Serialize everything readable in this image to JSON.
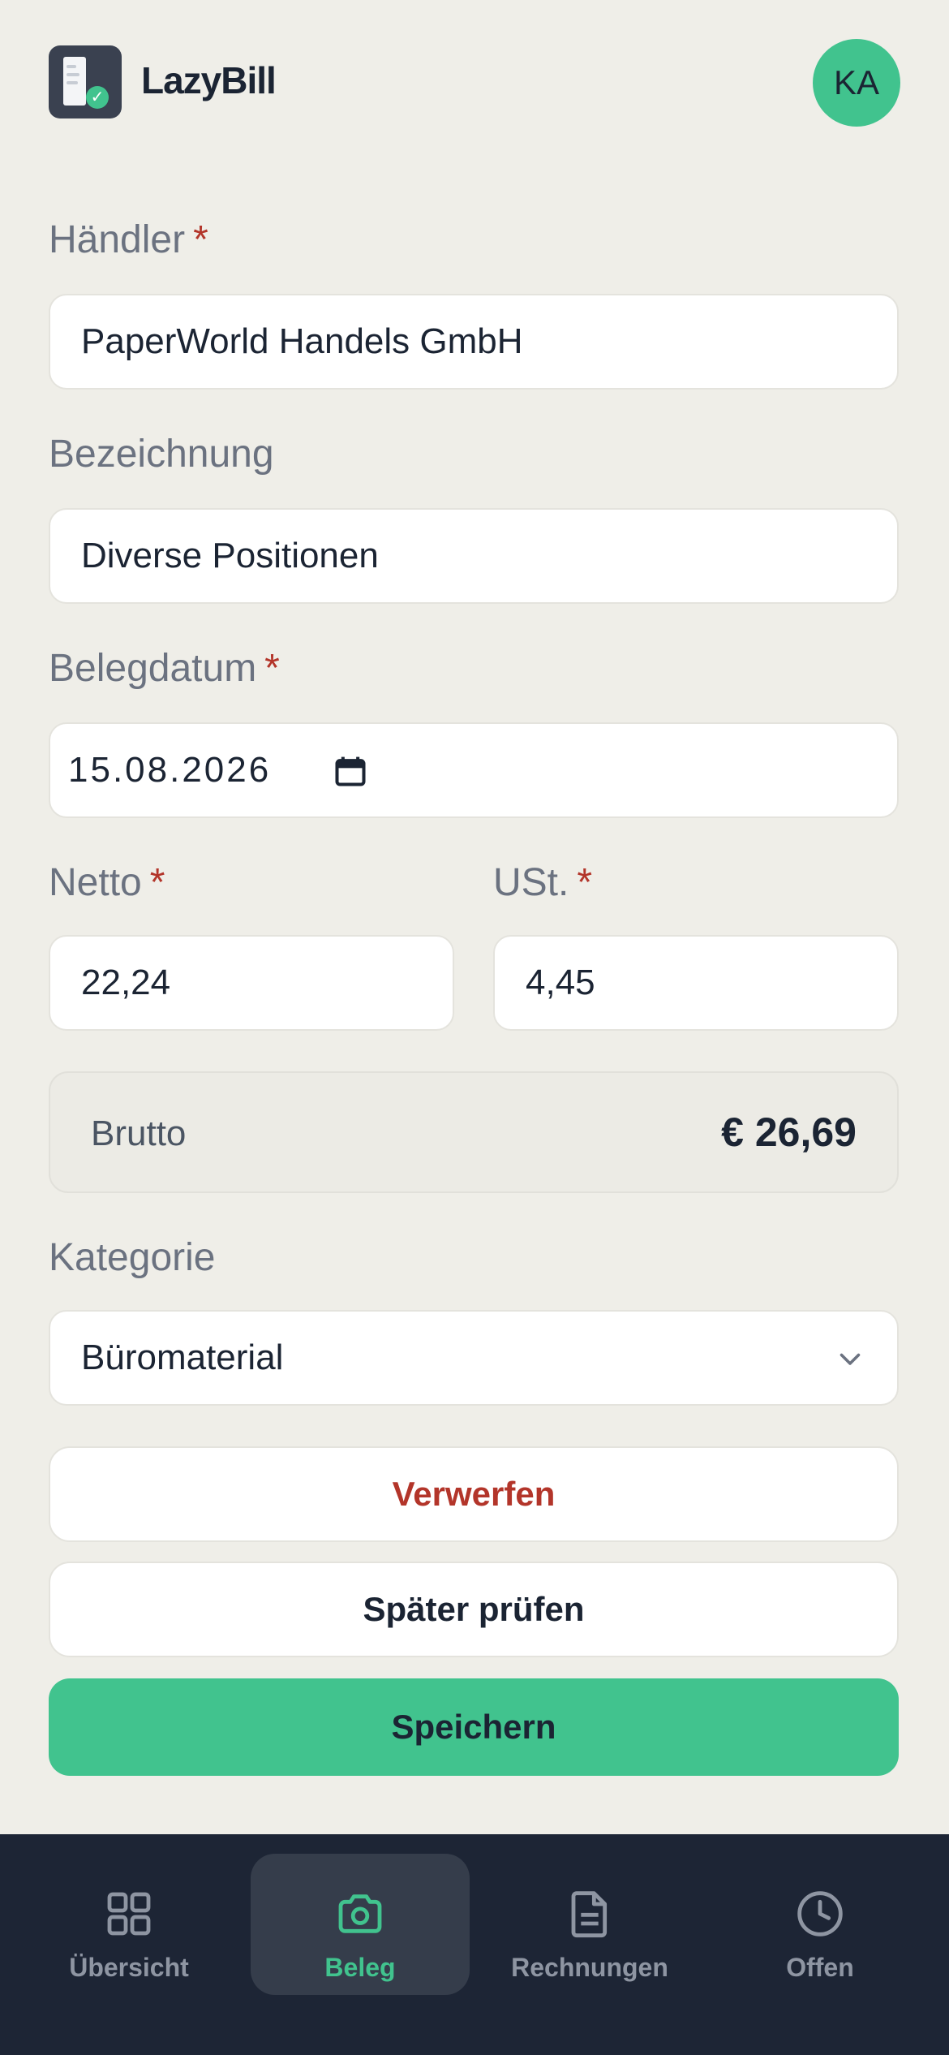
{
  "header": {
    "app_title": "LazyBill",
    "avatar_initials": "KA",
    "logo_icon": "receipt-check-icon"
  },
  "form": {
    "merchant": {
      "label": "Händler",
      "required_mark": "*",
      "value": "PaperWorld Handels GmbH"
    },
    "description": {
      "label": "Bezeichnung",
      "value": "Diverse Positionen"
    },
    "date": {
      "label": "Belegdatum",
      "required_mark": "*",
      "value": "15.08.2026"
    },
    "net": {
      "label": "Netto",
      "required_mark": "*",
      "value": "22,24"
    },
    "vat": {
      "label": "USt.",
      "required_mark": "*",
      "value": "4,45"
    },
    "gross": {
      "label": "Brutto",
      "value": "€ 26,69"
    },
    "category": {
      "label": "Kategorie",
      "value": "Büromaterial"
    }
  },
  "actions": {
    "discard": "Verwerfen",
    "later": "Später prüfen",
    "save": "Speichern"
  },
  "nav": {
    "items": [
      {
        "label": "Übersicht",
        "icon": "grid-icon",
        "active": false
      },
      {
        "label": "Beleg",
        "icon": "camera-icon",
        "active": true
      },
      {
        "label": "Rechnungen",
        "icon": "document-icon",
        "active": false
      },
      {
        "label": "Offen",
        "icon": "clock-icon",
        "active": false
      }
    ]
  },
  "colors": {
    "accent": "#41c38e",
    "danger": "#b3352a",
    "background": "#efeee8",
    "nav_background": "#1d2535"
  }
}
